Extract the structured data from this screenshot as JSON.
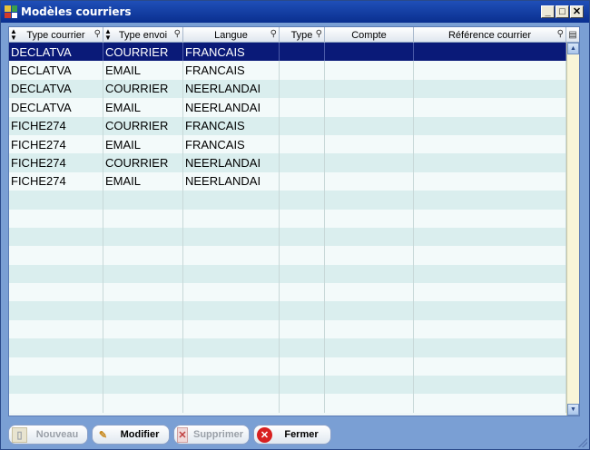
{
  "window": {
    "title": "Modèles courriers",
    "minimize_label": "_",
    "maximize_label": "□",
    "close_label": "✕"
  },
  "table": {
    "columns": [
      {
        "label": "Type courrier",
        "sortable": true,
        "searchable": true
      },
      {
        "label": "Type envoi",
        "sortable": true,
        "searchable": true
      },
      {
        "label": "Langue",
        "sortable": false,
        "searchable": true
      },
      {
        "label": "Type",
        "sortable": false,
        "searchable": true
      },
      {
        "label": "Compte",
        "sortable": false,
        "searchable": false
      },
      {
        "label": "Référence courrier",
        "sortable": false,
        "searchable": true
      }
    ],
    "rows": [
      [
        "DECLATVA",
        "COURRIER",
        "FRANCAIS",
        "",
        "",
        ""
      ],
      [
        "DECLATVA",
        "EMAIL",
        "FRANCAIS",
        "",
        "",
        ""
      ],
      [
        "DECLATVA",
        "COURRIER",
        "NEERLANDAI",
        "",
        "",
        ""
      ],
      [
        "DECLATVA",
        "EMAIL",
        "NEERLANDAI",
        "",
        "",
        ""
      ],
      [
        "FICHE274",
        "COURRIER",
        "FRANCAIS",
        "",
        "",
        ""
      ],
      [
        "FICHE274",
        "EMAIL",
        "FRANCAIS",
        "",
        "",
        ""
      ],
      [
        "FICHE274",
        "COURRIER",
        "NEERLANDAI",
        "",
        "",
        ""
      ],
      [
        "FICHE274",
        "EMAIL",
        "NEERLANDAI",
        "",
        "",
        ""
      ]
    ],
    "selected_row": 0,
    "empty_rows": 12,
    "colors": {
      "selected": "#0a1a78",
      "row_odd": "#daeeee",
      "row_even": "#f3fafa"
    }
  },
  "toolbar": {
    "new_label": "Nouveau",
    "edit_label": "Modifier",
    "delete_label": "Supprimer",
    "close_label": "Fermer"
  },
  "icons": {
    "sort": "sort-arrows-icon",
    "search": "magnifier-icon",
    "column_picker": "clipboard-icon",
    "new": "document-icon",
    "edit": "pencil-icon",
    "delete": "delete-document-icon",
    "close": "red-x-icon"
  }
}
